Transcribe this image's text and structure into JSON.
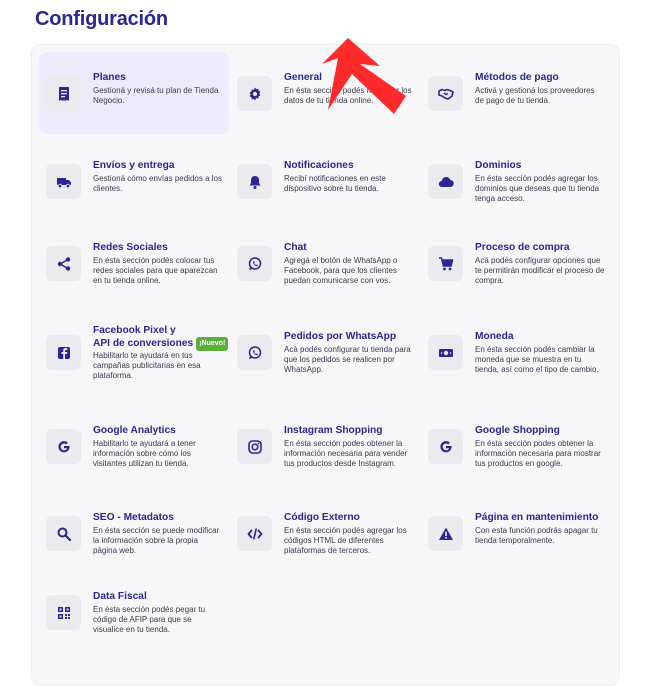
{
  "page": {
    "title": "Configuración"
  },
  "badge_new": "¡Nuevo!",
  "items": [
    {
      "title": "Planes",
      "desc": "Gestioná y revisá tu plan de Tienda Negocio.",
      "icon": "receipt-icon"
    },
    {
      "title": "General",
      "desc": "En ésta sección podés modificar los datos de tu tienda online.",
      "icon": "gear-icon"
    },
    {
      "title": "Métodos de pago",
      "desc": "Activá y gestioná los proveedores de pago de tu tienda.",
      "icon": "handshake-icon"
    },
    {
      "title": "Envíos y entrega",
      "desc": "Gestioná cómo envías pedidos a los clientes.",
      "icon": "truck-icon"
    },
    {
      "title": "Notificaciones",
      "desc": "Recibí notificaciones en este dispositivo sobre tu tienda.",
      "icon": "bell-icon"
    },
    {
      "title": "Dominios",
      "desc": "En ésta sección podés agregar los dominios que deseas que tu tienda tenga acceso.",
      "icon": "cloud-icon"
    },
    {
      "title": "Redes Sociales",
      "desc": "En ésta sección podés colocar tus redes sociales para que aparezcan en tu tienda online.",
      "icon": "share-icon"
    },
    {
      "title": "Chat",
      "desc": "Agregá el botón de WhatsApp o Facebook, para que los clientes puedan comunicarse con vos.",
      "icon": "whatsapp-icon"
    },
    {
      "title": "Proceso de compra",
      "desc": "Acá podés configurar opciones que te permitirán modificar el proceso de compra.",
      "icon": "cart-icon"
    },
    {
      "title": "Facebook Pixel y",
      "title2": "API de conversiones",
      "desc": "Habilitarlo te ayudará en tus campañas publicitarias en esa plataforma.",
      "icon": "facebook-icon"
    },
    {
      "title": "Pedidos por WhatsApp",
      "desc": "Acá podés configurar tu tienda para que los pedidos se realicen por WhatsApp.",
      "icon": "whatsapp-icon"
    },
    {
      "title": "Moneda",
      "desc": "En ésta sección podés cambiar la moneda que se muestra en tu tienda, así como el tipo de cambio.",
      "icon": "money-icon"
    },
    {
      "title": "Google Analytics",
      "desc": "Habilitarlo te ayudará a tener información sobre cómo los visitantes utilizan tu tienda.",
      "icon": "google-icon"
    },
    {
      "title": "Instagram Shopping",
      "desc": "En ésta sección podes obtener la información necesaria para vender tus productos desde Instagram.",
      "icon": "instagram-icon"
    },
    {
      "title": "Google Shopping",
      "desc": "En ésta sección podes obtener la información necesaria para mostrar tus productos en google.",
      "icon": "google-icon"
    },
    {
      "title": "SEO - Metadatos",
      "desc": "En ésta sección se puede modificar la información sobre la propia página web.",
      "icon": "search-icon"
    },
    {
      "title": "Código Externo",
      "desc": "En ésta sección podés agregar los códigos HTML de diferentes plataformas de terceros.",
      "icon": "code-icon"
    },
    {
      "title": "Página en mantenimiento",
      "desc": "Con esta función podrás apagar tu tienda temporalmente.",
      "icon": "warning-icon"
    },
    {
      "title": "Data Fiscal",
      "desc": "En ésta sección podés pegar tu código de AFIP para que se visualice en tu tienda.",
      "icon": "qr-icon"
    }
  ]
}
